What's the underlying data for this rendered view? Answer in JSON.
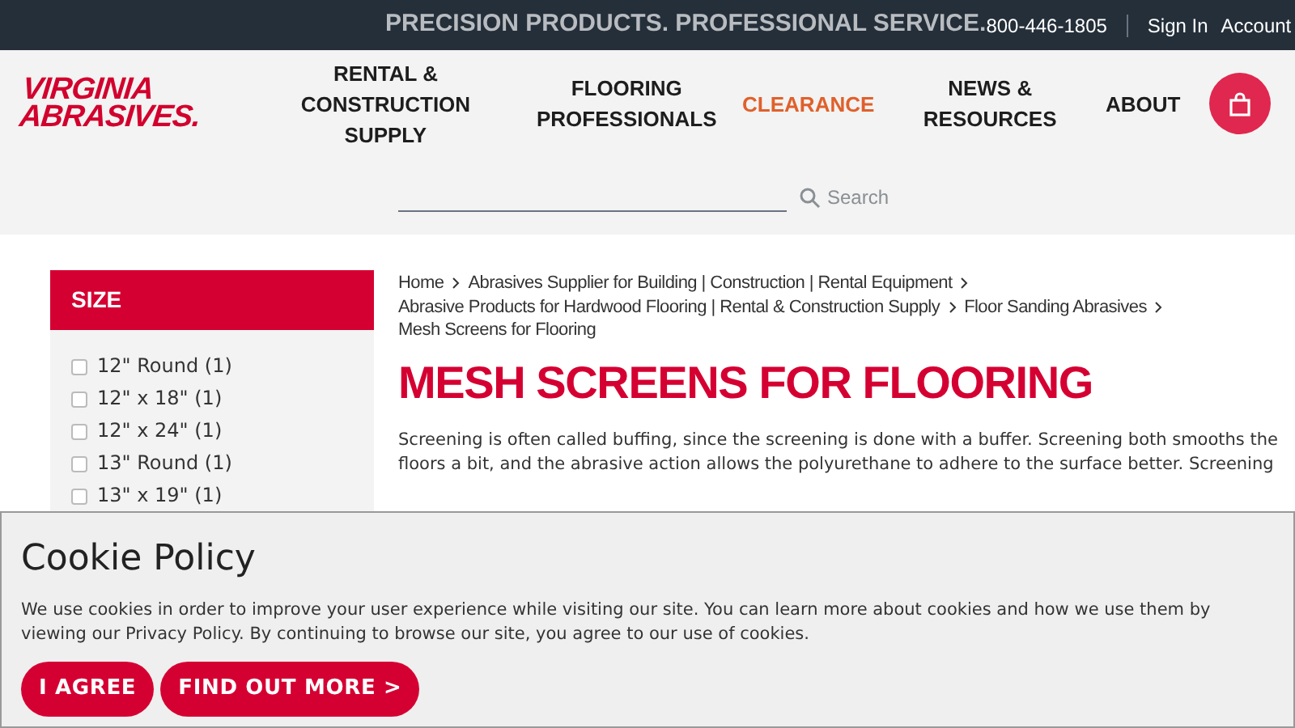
{
  "top_bar": {
    "tagline": "PRECISION PRODUCTS. PROFESSIONAL SERVICE.",
    "phone": "800-446-1805",
    "links": [
      "Sign In",
      "Account"
    ]
  },
  "logo": {
    "line_1": "VIRGINIA",
    "line_2": "ABRASIVES."
  },
  "nav": [
    {
      "label": "RENTAL & CONSTRUCTION SUPPLY",
      "highlight": false
    },
    {
      "label": "FLOORING PROFESSIONALS",
      "highlight": false
    },
    {
      "label": "CLEARANCE",
      "highlight": true
    },
    {
      "label": "NEWS & RESOURCES",
      "highlight": false
    },
    {
      "label": "ABOUT",
      "highlight": false
    }
  ],
  "search": {
    "placeholder": "Search"
  },
  "sidebar": {
    "title": "SIZE",
    "options": [
      {
        "label": "12\" Round (1)",
        "checked": false
      },
      {
        "label": "12\" x 18\" (1)",
        "checked": false
      },
      {
        "label": "12\" x 24\" (1)",
        "checked": false
      },
      {
        "label": "13\" Round (1)",
        "checked": false
      },
      {
        "label": "13\" x 19\" (1)",
        "checked": false
      }
    ]
  },
  "breadcrumbs": [
    "Home",
    "Abrasives Supplier for Building | Construction | Rental Equipment",
    "Abrasive Products for Hardwood Flooring | Rental & Construction Supply",
    "Floor Sanding Abrasives",
    "Mesh Screens for Flooring"
  ],
  "page_title": "MESH SCREENS FOR FLOORING",
  "intro": "Screening is often called buffing, since the screening is done with a buffer. Screening both smooths the floors a bit, and the abrasive action allows the polyurethane to adhere to the surface better. Screening",
  "cookie_banner": {
    "title": "Cookie Policy",
    "text": "We use cookies in order to improve your user experience while visiting our site. You can learn more about cookies and how we use them by viewing our Privacy Policy. By continuing to browse our site, you agree to our use of cookies.",
    "buttons": [
      "I AGREE",
      "FIND OUT MORE >"
    ]
  }
}
